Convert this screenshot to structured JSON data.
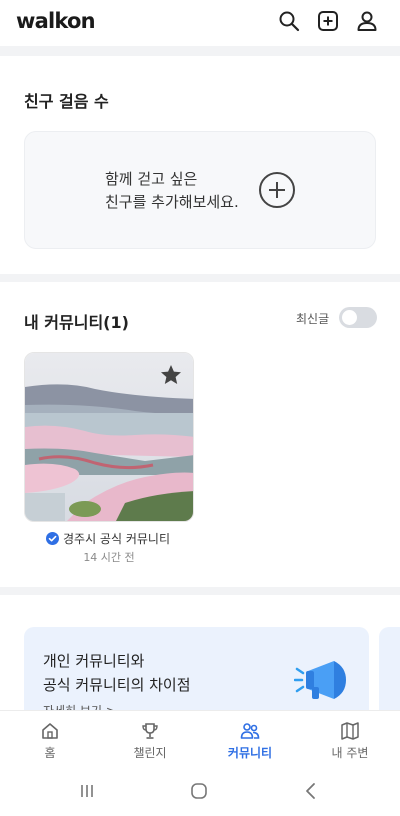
{
  "app": {
    "logo": "walkon"
  },
  "header": {
    "icons": [
      "search-icon",
      "add-square-icon",
      "profile-icon"
    ]
  },
  "friends": {
    "title": "친구 걸음 수",
    "empty_line1": "함께 걷고 싶은",
    "empty_line2": "친구를 추가해보세요."
  },
  "community": {
    "title": "내 커뮤니티(1)",
    "sort_label": "최신글",
    "sort_toggle_on": false,
    "items": [
      {
        "name": "경주시 공식 커뮤니티",
        "time": "14 시간 전",
        "verified": true,
        "starred": true
      }
    ]
  },
  "banner": {
    "line1": "개인 커뮤니티와",
    "line2": "공식 커뮤니티의 차이점",
    "link": "자세히 보기 >"
  },
  "tabs": [
    {
      "label": "홈",
      "icon": "home-icon",
      "active": false
    },
    {
      "label": "챌린지",
      "icon": "trophy-icon",
      "active": false
    },
    {
      "label": "커뮤니티",
      "icon": "people-icon",
      "active": true
    },
    {
      "label": "내 주변",
      "icon": "map-icon",
      "active": false
    }
  ],
  "colors": {
    "accent": "#2f6fe4",
    "card_bg": "#f7f8fa",
    "banner_bg": "#ebf2fd"
  }
}
